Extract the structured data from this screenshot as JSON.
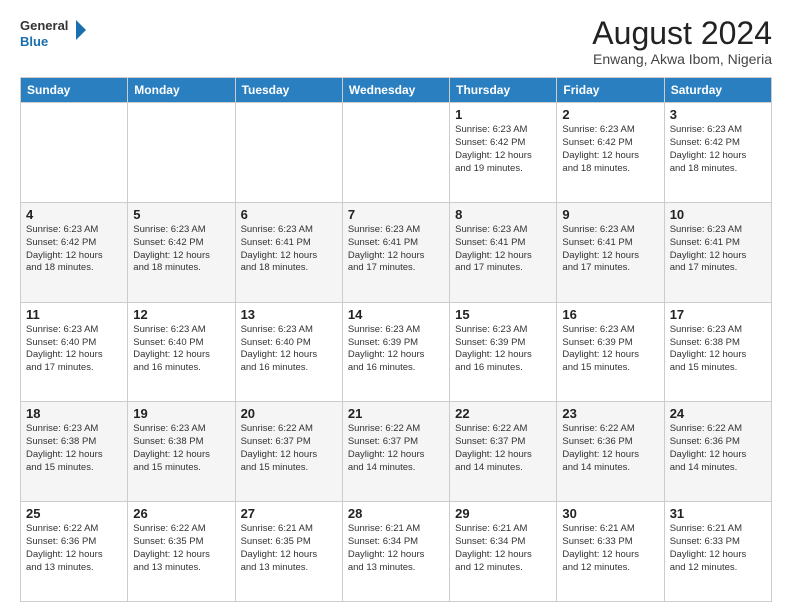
{
  "logo": {
    "line1": "General",
    "line2": "Blue"
  },
  "header": {
    "month_year": "August 2024",
    "location": "Enwang, Akwa Ibom, Nigeria"
  },
  "days_of_week": [
    "Sunday",
    "Monday",
    "Tuesday",
    "Wednesday",
    "Thursday",
    "Friday",
    "Saturday"
  ],
  "weeks": [
    [
      {
        "day": "",
        "info": ""
      },
      {
        "day": "",
        "info": ""
      },
      {
        "day": "",
        "info": ""
      },
      {
        "day": "",
        "info": ""
      },
      {
        "day": "1",
        "info": "Sunrise: 6:23 AM\nSunset: 6:42 PM\nDaylight: 12 hours\nand 19 minutes."
      },
      {
        "day": "2",
        "info": "Sunrise: 6:23 AM\nSunset: 6:42 PM\nDaylight: 12 hours\nand 18 minutes."
      },
      {
        "day": "3",
        "info": "Sunrise: 6:23 AM\nSunset: 6:42 PM\nDaylight: 12 hours\nand 18 minutes."
      }
    ],
    [
      {
        "day": "4",
        "info": "Sunrise: 6:23 AM\nSunset: 6:42 PM\nDaylight: 12 hours\nand 18 minutes."
      },
      {
        "day": "5",
        "info": "Sunrise: 6:23 AM\nSunset: 6:42 PM\nDaylight: 12 hours\nand 18 minutes."
      },
      {
        "day": "6",
        "info": "Sunrise: 6:23 AM\nSunset: 6:41 PM\nDaylight: 12 hours\nand 18 minutes."
      },
      {
        "day": "7",
        "info": "Sunrise: 6:23 AM\nSunset: 6:41 PM\nDaylight: 12 hours\nand 17 minutes."
      },
      {
        "day": "8",
        "info": "Sunrise: 6:23 AM\nSunset: 6:41 PM\nDaylight: 12 hours\nand 17 minutes."
      },
      {
        "day": "9",
        "info": "Sunrise: 6:23 AM\nSunset: 6:41 PM\nDaylight: 12 hours\nand 17 minutes."
      },
      {
        "day": "10",
        "info": "Sunrise: 6:23 AM\nSunset: 6:41 PM\nDaylight: 12 hours\nand 17 minutes."
      }
    ],
    [
      {
        "day": "11",
        "info": "Sunrise: 6:23 AM\nSunset: 6:40 PM\nDaylight: 12 hours\nand 17 minutes."
      },
      {
        "day": "12",
        "info": "Sunrise: 6:23 AM\nSunset: 6:40 PM\nDaylight: 12 hours\nand 16 minutes."
      },
      {
        "day": "13",
        "info": "Sunrise: 6:23 AM\nSunset: 6:40 PM\nDaylight: 12 hours\nand 16 minutes."
      },
      {
        "day": "14",
        "info": "Sunrise: 6:23 AM\nSunset: 6:39 PM\nDaylight: 12 hours\nand 16 minutes."
      },
      {
        "day": "15",
        "info": "Sunrise: 6:23 AM\nSunset: 6:39 PM\nDaylight: 12 hours\nand 16 minutes."
      },
      {
        "day": "16",
        "info": "Sunrise: 6:23 AM\nSunset: 6:39 PM\nDaylight: 12 hours\nand 15 minutes."
      },
      {
        "day": "17",
        "info": "Sunrise: 6:23 AM\nSunset: 6:38 PM\nDaylight: 12 hours\nand 15 minutes."
      }
    ],
    [
      {
        "day": "18",
        "info": "Sunrise: 6:23 AM\nSunset: 6:38 PM\nDaylight: 12 hours\nand 15 minutes."
      },
      {
        "day": "19",
        "info": "Sunrise: 6:23 AM\nSunset: 6:38 PM\nDaylight: 12 hours\nand 15 minutes."
      },
      {
        "day": "20",
        "info": "Sunrise: 6:22 AM\nSunset: 6:37 PM\nDaylight: 12 hours\nand 15 minutes."
      },
      {
        "day": "21",
        "info": "Sunrise: 6:22 AM\nSunset: 6:37 PM\nDaylight: 12 hours\nand 14 minutes."
      },
      {
        "day": "22",
        "info": "Sunrise: 6:22 AM\nSunset: 6:37 PM\nDaylight: 12 hours\nand 14 minutes."
      },
      {
        "day": "23",
        "info": "Sunrise: 6:22 AM\nSunset: 6:36 PM\nDaylight: 12 hours\nand 14 minutes."
      },
      {
        "day": "24",
        "info": "Sunrise: 6:22 AM\nSunset: 6:36 PM\nDaylight: 12 hours\nand 14 minutes."
      }
    ],
    [
      {
        "day": "25",
        "info": "Sunrise: 6:22 AM\nSunset: 6:36 PM\nDaylight: 12 hours\nand 13 minutes."
      },
      {
        "day": "26",
        "info": "Sunrise: 6:22 AM\nSunset: 6:35 PM\nDaylight: 12 hours\nand 13 minutes."
      },
      {
        "day": "27",
        "info": "Sunrise: 6:21 AM\nSunset: 6:35 PM\nDaylight: 12 hours\nand 13 minutes."
      },
      {
        "day": "28",
        "info": "Sunrise: 6:21 AM\nSunset: 6:34 PM\nDaylight: 12 hours\nand 13 minutes."
      },
      {
        "day": "29",
        "info": "Sunrise: 6:21 AM\nSunset: 6:34 PM\nDaylight: 12 hours\nand 12 minutes."
      },
      {
        "day": "30",
        "info": "Sunrise: 6:21 AM\nSunset: 6:33 PM\nDaylight: 12 hours\nand 12 minutes."
      },
      {
        "day": "31",
        "info": "Sunrise: 6:21 AM\nSunset: 6:33 PM\nDaylight: 12 hours\nand 12 minutes."
      }
    ]
  ]
}
